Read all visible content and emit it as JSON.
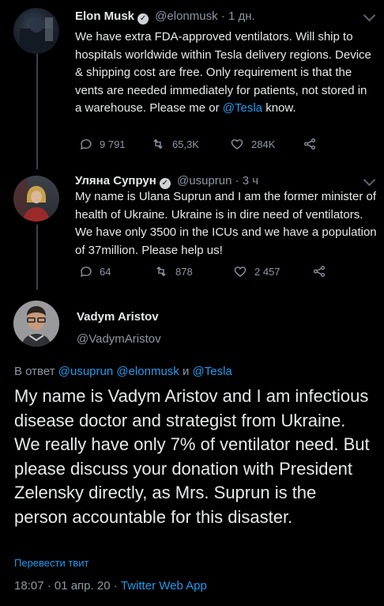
{
  "tweet1": {
    "name": "Elon Musk",
    "handle": "@elonmusk",
    "time": "· 1 дн.",
    "text_before": "We have extra FDA-approved ventilators. Will ship to hospitals worldwide within Tesla delivery regions. Device & shipping cost are free. Only requirement is that the vents are needed immediately for patients, not stored in a warehouse. Please me or ",
    "text_link": "@Tesla",
    "text_after": " know.",
    "replies": "9 791",
    "retweets": "65,3K",
    "likes": "284K"
  },
  "tweet2": {
    "name": "Уляна Супрун",
    "handle": "@usuprun",
    "time": "· 3 ч",
    "text": "My name is Ulana Suprun and I am the former minister of health of Ukraine. Ukraine is in dire need of ventilators. We have only 3500 in the ICUs and we have a population of  37million. Please help us!",
    "replies": "64",
    "retweets": "878",
    "likes": "2 457"
  },
  "main_tweet": {
    "name": "Vadym Aristov",
    "handle": "@VadymAristov",
    "reply_prefix": "В ответ",
    "reply_to1": "@usuprun",
    "reply_to2": "@elonmusk",
    "reply_and": "и",
    "reply_to3": "@Tesla",
    "text": "My name is Vadym Aristov and I am infectious disease doctor and strategist from Ukraine. We really have only 7% of ventilator need. But please discuss your donation with President Zelensky directly, as Mrs. Suprun is the person accountable for this disaster.",
    "translate": "Перевести твит",
    "timestamp": "18:07 · 01 апр. 20 · ",
    "source": "Twitter Web App"
  },
  "colors": {
    "background": "#000000",
    "link": "#1d9bf0",
    "muted": "#8b98a5"
  }
}
